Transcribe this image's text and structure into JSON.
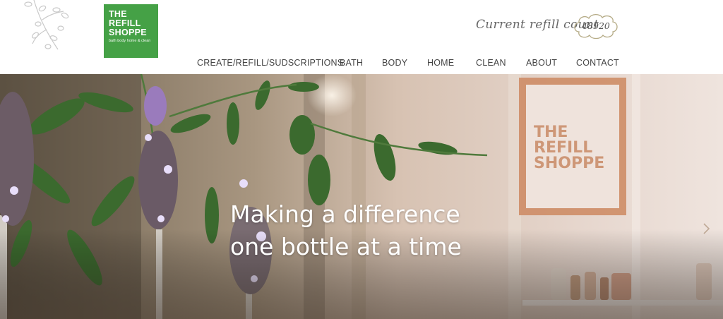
{
  "brand": {
    "line1": "THE",
    "line2": "REFILL",
    "line3": "SHOPPE",
    "tagline": "bath body home & clean",
    "color": "#45a146"
  },
  "counter": {
    "label": "Current refill count",
    "value": "48920"
  },
  "nav": {
    "items": [
      {
        "label": "CREATE/REFILL/SUDSCRIPTIONS"
      },
      {
        "label": "BATH"
      },
      {
        "label": "BODY"
      },
      {
        "label": "HOME"
      },
      {
        "label": "CLEAN"
      },
      {
        "label": "ABOUT"
      },
      {
        "label": "CONTACT"
      }
    ]
  },
  "hero": {
    "line1": "Making a difference",
    "line2": "one bottle at a time",
    "sign_line1": "THE",
    "sign_line2": "REFILL",
    "sign_line3": "SHOPPE",
    "next_icon": "chevron-right-icon"
  }
}
